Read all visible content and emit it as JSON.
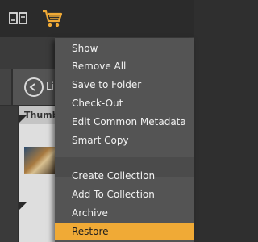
{
  "toolbar": {
    "icons": [
      "compare-icon",
      "shopping-cart-icon"
    ]
  },
  "background": {
    "share_label": "Li",
    "thumbnail_header": "Thumb"
  },
  "menu": {
    "items": [
      {
        "label": "Show"
      },
      {
        "label": "Remove All"
      },
      {
        "label": "Save to Folder"
      },
      {
        "label": "Check-Out"
      },
      {
        "label": "Edit Common Metadata"
      },
      {
        "label": "Smart Copy"
      },
      {
        "label": "Create Collection"
      },
      {
        "label": "Add To Collection"
      },
      {
        "label": "Archive"
      },
      {
        "label": "Restore",
        "highlighted": true
      }
    ]
  },
  "colors": {
    "highlight": "#f0aa36",
    "menu_bg": "#545454",
    "toolbar_bg": "#2b2b2b"
  }
}
